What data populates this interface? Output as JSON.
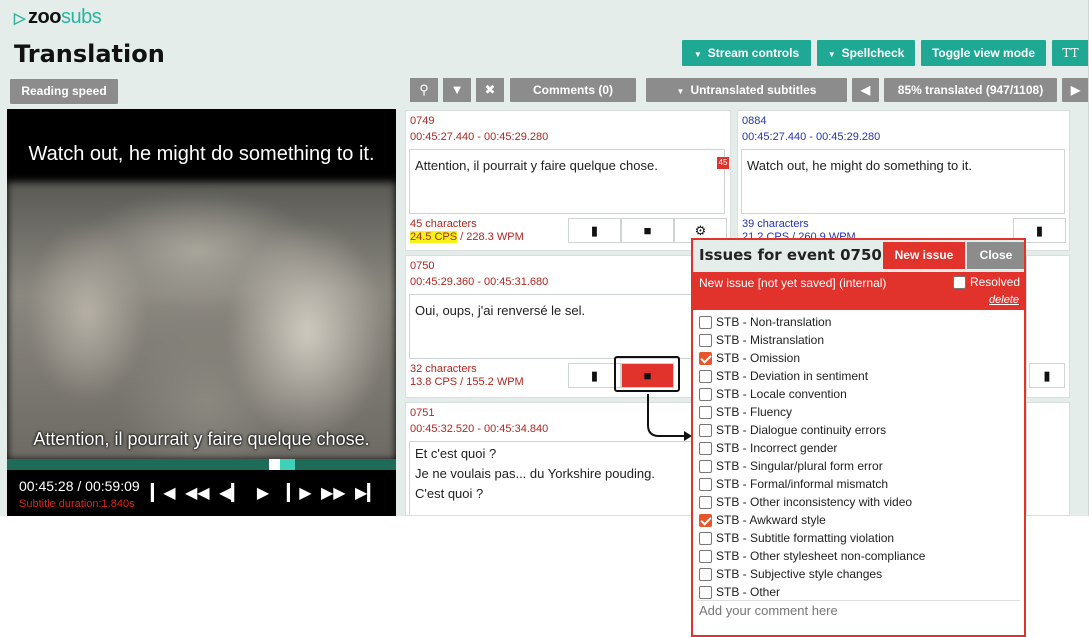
{
  "header": {
    "logo_main": "zoo",
    "logo_sub": "subs",
    "title": "Translation"
  },
  "top_buttons": {
    "stream_controls": "Stream controls",
    "spellcheck": "Spellcheck",
    "toggle_view": "Toggle view mode",
    "font_size": "TT"
  },
  "toolbar": {
    "reading_speed": "Reading speed",
    "comments": "Comments (0)",
    "filter_select": "Untranslated subtitles",
    "progress": "85% translated (947/1108)",
    "progress_fraction": 0.855
  },
  "player": {
    "subtitle_top": "Watch out, he might do something to it.",
    "subtitle_bottom": "Attention, il pourrait y faire quelque chose.",
    "timecode": "00:45:28 / 00:59:09",
    "duration": "Subtitle duration:1.840s"
  },
  "events": [
    {
      "id": "0749",
      "time": "00:45:27.440 - 00:45:29.280",
      "text": "Attention, il pourrait y faire quelque chose.",
      "chars": "45 characters",
      "cps": "24.5 CPS",
      "wpm": " / 228.3 WPM",
      "flag": "45"
    },
    {
      "id": "0750",
      "time": "00:45:29.360 - 00:45:31.680",
      "text": "Oui, oups, j'ai renversé le sel.",
      "chars": "32 characters",
      "cps_wpm": "13.8 CPS / 155.2 WPM"
    },
    {
      "id": "0751",
      "time": "00:45:32.520 - 00:45:34.840",
      "line1": "Et c'est quoi ?",
      "line2": "Je ne voulais pas... du Yorkshire pouding.",
      "line3": "C'est quoi ?"
    }
  ],
  "source_event": {
    "id": "0884",
    "time": "00:45:27.440 - 00:45:29.280",
    "text": "Watch out, he might do something to it.",
    "chars": "39 characters",
    "cps_wpm": "21.2 CPS / 260.9 WPM"
  },
  "issues_panel": {
    "title": "Issues for event 0750",
    "new_issue": "New issue",
    "close": "Close",
    "issue_label": "New issue [not yet saved] (internal)",
    "resolved": "Resolved",
    "delete": "delete",
    "categories": [
      {
        "label": "STB - Non-translation",
        "checked": false
      },
      {
        "label": "STB - Mistranslation",
        "checked": false
      },
      {
        "label": "STB - Omission",
        "checked": true
      },
      {
        "label": "STB - Deviation in sentiment",
        "checked": false
      },
      {
        "label": "STB - Locale convention",
        "checked": false
      },
      {
        "label": "STB - Fluency",
        "checked": false
      },
      {
        "label": "STB - Dialogue continuity errors",
        "checked": false
      },
      {
        "label": "STB - Incorrect gender",
        "checked": false
      },
      {
        "label": "STB - Singular/plural form error",
        "checked": false
      },
      {
        "label": "STB - Formal/informal mismatch",
        "checked": false
      },
      {
        "label": "STB - Other inconsistency with video",
        "checked": false
      },
      {
        "label": "STB - Awkward style",
        "checked": true
      },
      {
        "label": "STB - Subtitle formatting violation",
        "checked": false
      },
      {
        "label": "STB - Other stylesheet non-compliance",
        "checked": false
      },
      {
        "label": "STB - Subjective style changes",
        "checked": false
      },
      {
        "label": "STB - Other",
        "checked": false
      }
    ],
    "comment_placeholder": "Add your comment here"
  },
  "colors": {
    "accent": "#1fa893",
    "alert": "#e1322c",
    "background": "#e4ede9"
  }
}
